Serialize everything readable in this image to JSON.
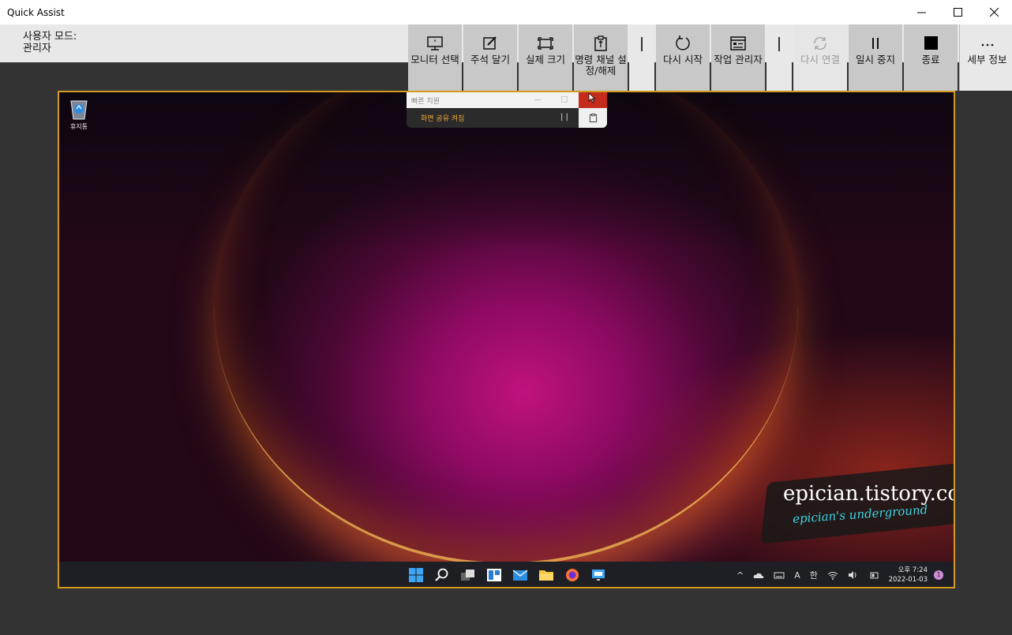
{
  "window": {
    "title": "Quick Assist"
  },
  "mode": {
    "line1": "사용자 모드:",
    "line2": "관리자"
  },
  "toolbar": {
    "select_monitor": "모니터 선택",
    "annotate": "주석 달기",
    "actual_size": "실제 크기",
    "toggle_command_channel": "명령 채널 설정/해제",
    "restart": "다시 시작",
    "task_manager": "작업 관리자",
    "reconnect": "다시 연결",
    "pause": "일시 중지",
    "end": "종료",
    "details": "세부 정보"
  },
  "remote": {
    "recycle_bin": "휴지통",
    "mini_title": "빠른 지원",
    "mini_status": "화면 공유 켜짐",
    "watermark_main": "epician.tistory.com",
    "watermark_sub": "epician's underground",
    "taskbar": {
      "ime": "A",
      "lang": "한",
      "time": "오후 7:24",
      "date": "2022-01-03",
      "notifications": "1"
    }
  },
  "colors": {
    "frame_border": "#d39b1e",
    "close_red": "#c42b1c",
    "status_orange": "#e7a33c"
  }
}
